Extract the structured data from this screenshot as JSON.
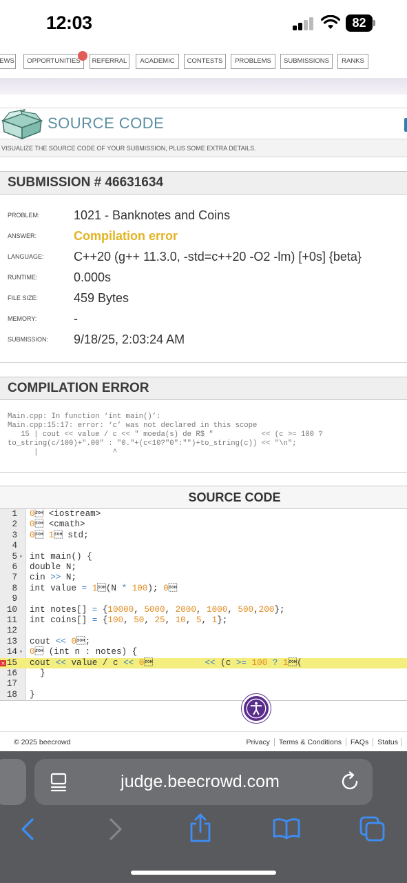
{
  "status_bar": {
    "time": "12:03",
    "battery": "82"
  },
  "nav": {
    "tabs": [
      "EWS",
      "OPPORTUNITIES",
      "REFERRAL",
      "ACADEMIC",
      "CONTESTS",
      "PROBLEMS",
      "SUBMISSIONS",
      "RANKS"
    ]
  },
  "banner": {
    "title": "SOURCE CODE",
    "description": "VISUALIZE THE SOURCE CODE OF YOUR SUBMISSION, PLUS SOME EXTRA DETAILS."
  },
  "submission": {
    "title": "SUBMISSION # 46631634",
    "fields": [
      {
        "label": "PROBLEM:",
        "value": "1021 - Banknotes and Coins"
      },
      {
        "label": "ANSWER:",
        "value": "Compilation error"
      },
      {
        "label": "LANGUAGE:",
        "value": "C++20 (g++ 11.3.0, -std=c++20 -O2 -lm) [+0s] {beta}"
      },
      {
        "label": "RUNTIME:",
        "value": "0.000s"
      },
      {
        "label": "FILE SIZE:",
        "value": "459 Bytes"
      },
      {
        "label": "MEMORY:",
        "value": "-"
      },
      {
        "label": "SUBMISSION:",
        "value": "9/18/25, 2:03:24 AM"
      }
    ]
  },
  "compilation": {
    "title": "COMPILATION ERROR",
    "message": "Main.cpp: In function ‘int main()’:\nMain.cpp:15:17: error: ‘c’ was not declared in this scope\n   15 | cout << value / c << \" moeda(s) de R$ \"           << (c >= 100 ?\nto_string(c/100)+\".00\" : \"0.\"+(c<10?\"0\":\"\")+to_string(c)) << \"\\n\";\n      |                 ^"
  },
  "source": {
    "title": "SOURCE CODE",
    "error_line": 15,
    "lines": [
      "#include <iostream>",
      "#include <cmath>",
      "using namespace std;",
      "",
      "int main() {",
      "double N;",
      "cin >> N;",
      "int value = round(N * 100); // convert to cents",
      "",
      "int notes[] = {10000, 5000, 2000, 1000, 500,200};",
      "int coins[] = {100, 50, 25, 10, 5, 1};",
      "",
      "cout << \"NOTAS:\\n\";",
      "for (int n : notes) {",
      "cout << value / c << \" moeda(s) de R$ \"          << (c >= 100 ? to_string(",
      "  }",
      "",
      "}"
    ]
  },
  "footer": {
    "copyright": "© 2025 beecrowd",
    "links": [
      "Privacy",
      "Terms & Conditions",
      "FAQs",
      "Status"
    ]
  },
  "browser": {
    "url": "judge.beecrowd.com"
  },
  "colors": {
    "accent": "#5b8ea0",
    "error": "#e2b423",
    "highlight": "#f4ee7e",
    "a11y": "#5a2d8c"
  }
}
